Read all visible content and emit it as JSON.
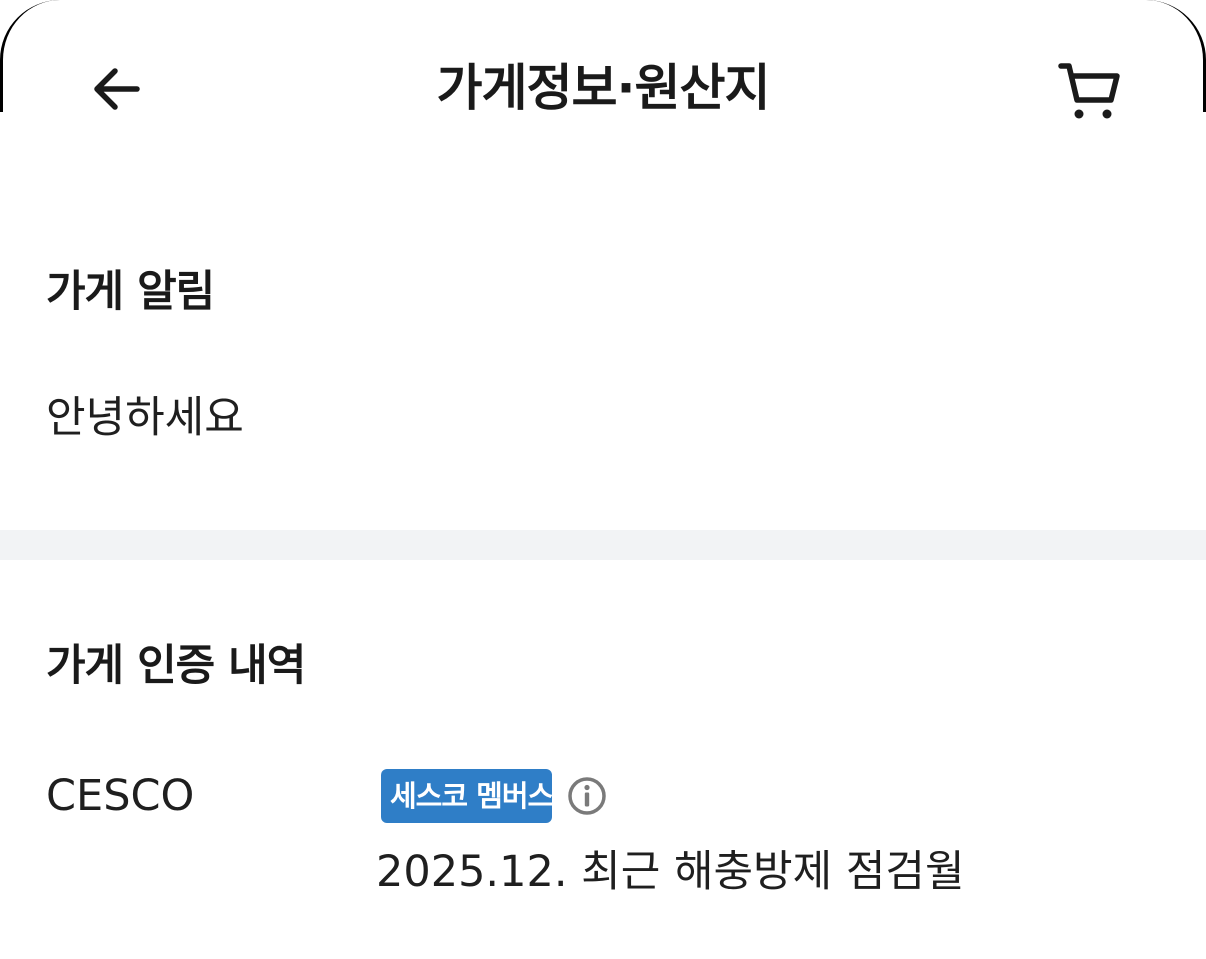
{
  "header": {
    "title": "가게정보·원산지",
    "back_icon": "back-arrow-icon",
    "cart_icon": "cart-icon"
  },
  "notice": {
    "title": "가게 알림",
    "text": "안녕하세요"
  },
  "certification": {
    "title": "가게 인증 내역",
    "items": [
      {
        "name": "CESCO",
        "badge": "세스코 멤버스",
        "badge_color": "#2f7ec7",
        "info_icon": "info-icon",
        "detail": "2025.12. 최근 해충방제 점검월"
      }
    ]
  }
}
